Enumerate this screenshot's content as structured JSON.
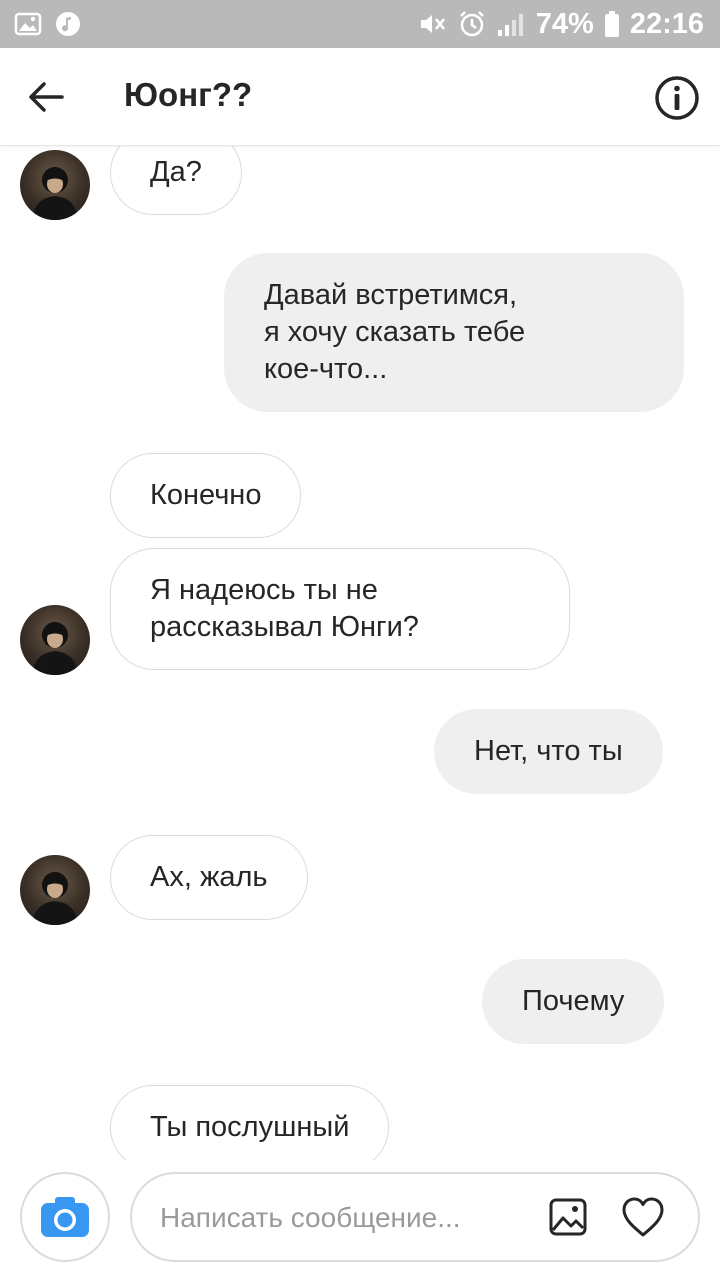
{
  "status_bar": {
    "battery": "74%",
    "time": "22:16",
    "icons": [
      "image-icon",
      "music-icon",
      "mute-icon",
      "alarm-icon",
      "signal-icon",
      "battery-icon"
    ]
  },
  "header": {
    "title": "Юонг??",
    "icons": [
      "back-arrow-icon",
      "info-icon"
    ]
  },
  "messages": [
    {
      "side": "in",
      "text": "Да?"
    },
    {
      "side": "out",
      "text": "Давай встретимся,\nя хочу сказать тебе\nкое-что..."
    },
    {
      "side": "in",
      "text": "Конечно"
    },
    {
      "side": "in",
      "text": "Я надеюсь ты не\nрассказывал Юнги?"
    },
    {
      "side": "out",
      "text": "Нет, что ты"
    },
    {
      "side": "in",
      "text": "Ах, жаль"
    },
    {
      "side": "out",
      "text": "Почему"
    },
    {
      "side": "in",
      "text": "Ты послушный"
    }
  ],
  "composer": {
    "placeholder": "Написать сообщение...",
    "icons": [
      "camera-icon",
      "gallery-icon",
      "heart-icon"
    ]
  },
  "colors": {
    "status_bar": "#b9b9b9",
    "outgoing_bubble": "#efefef",
    "incoming_border": "#dbdbdb",
    "camera_accent": "#3897f0",
    "text": "#262626"
  }
}
